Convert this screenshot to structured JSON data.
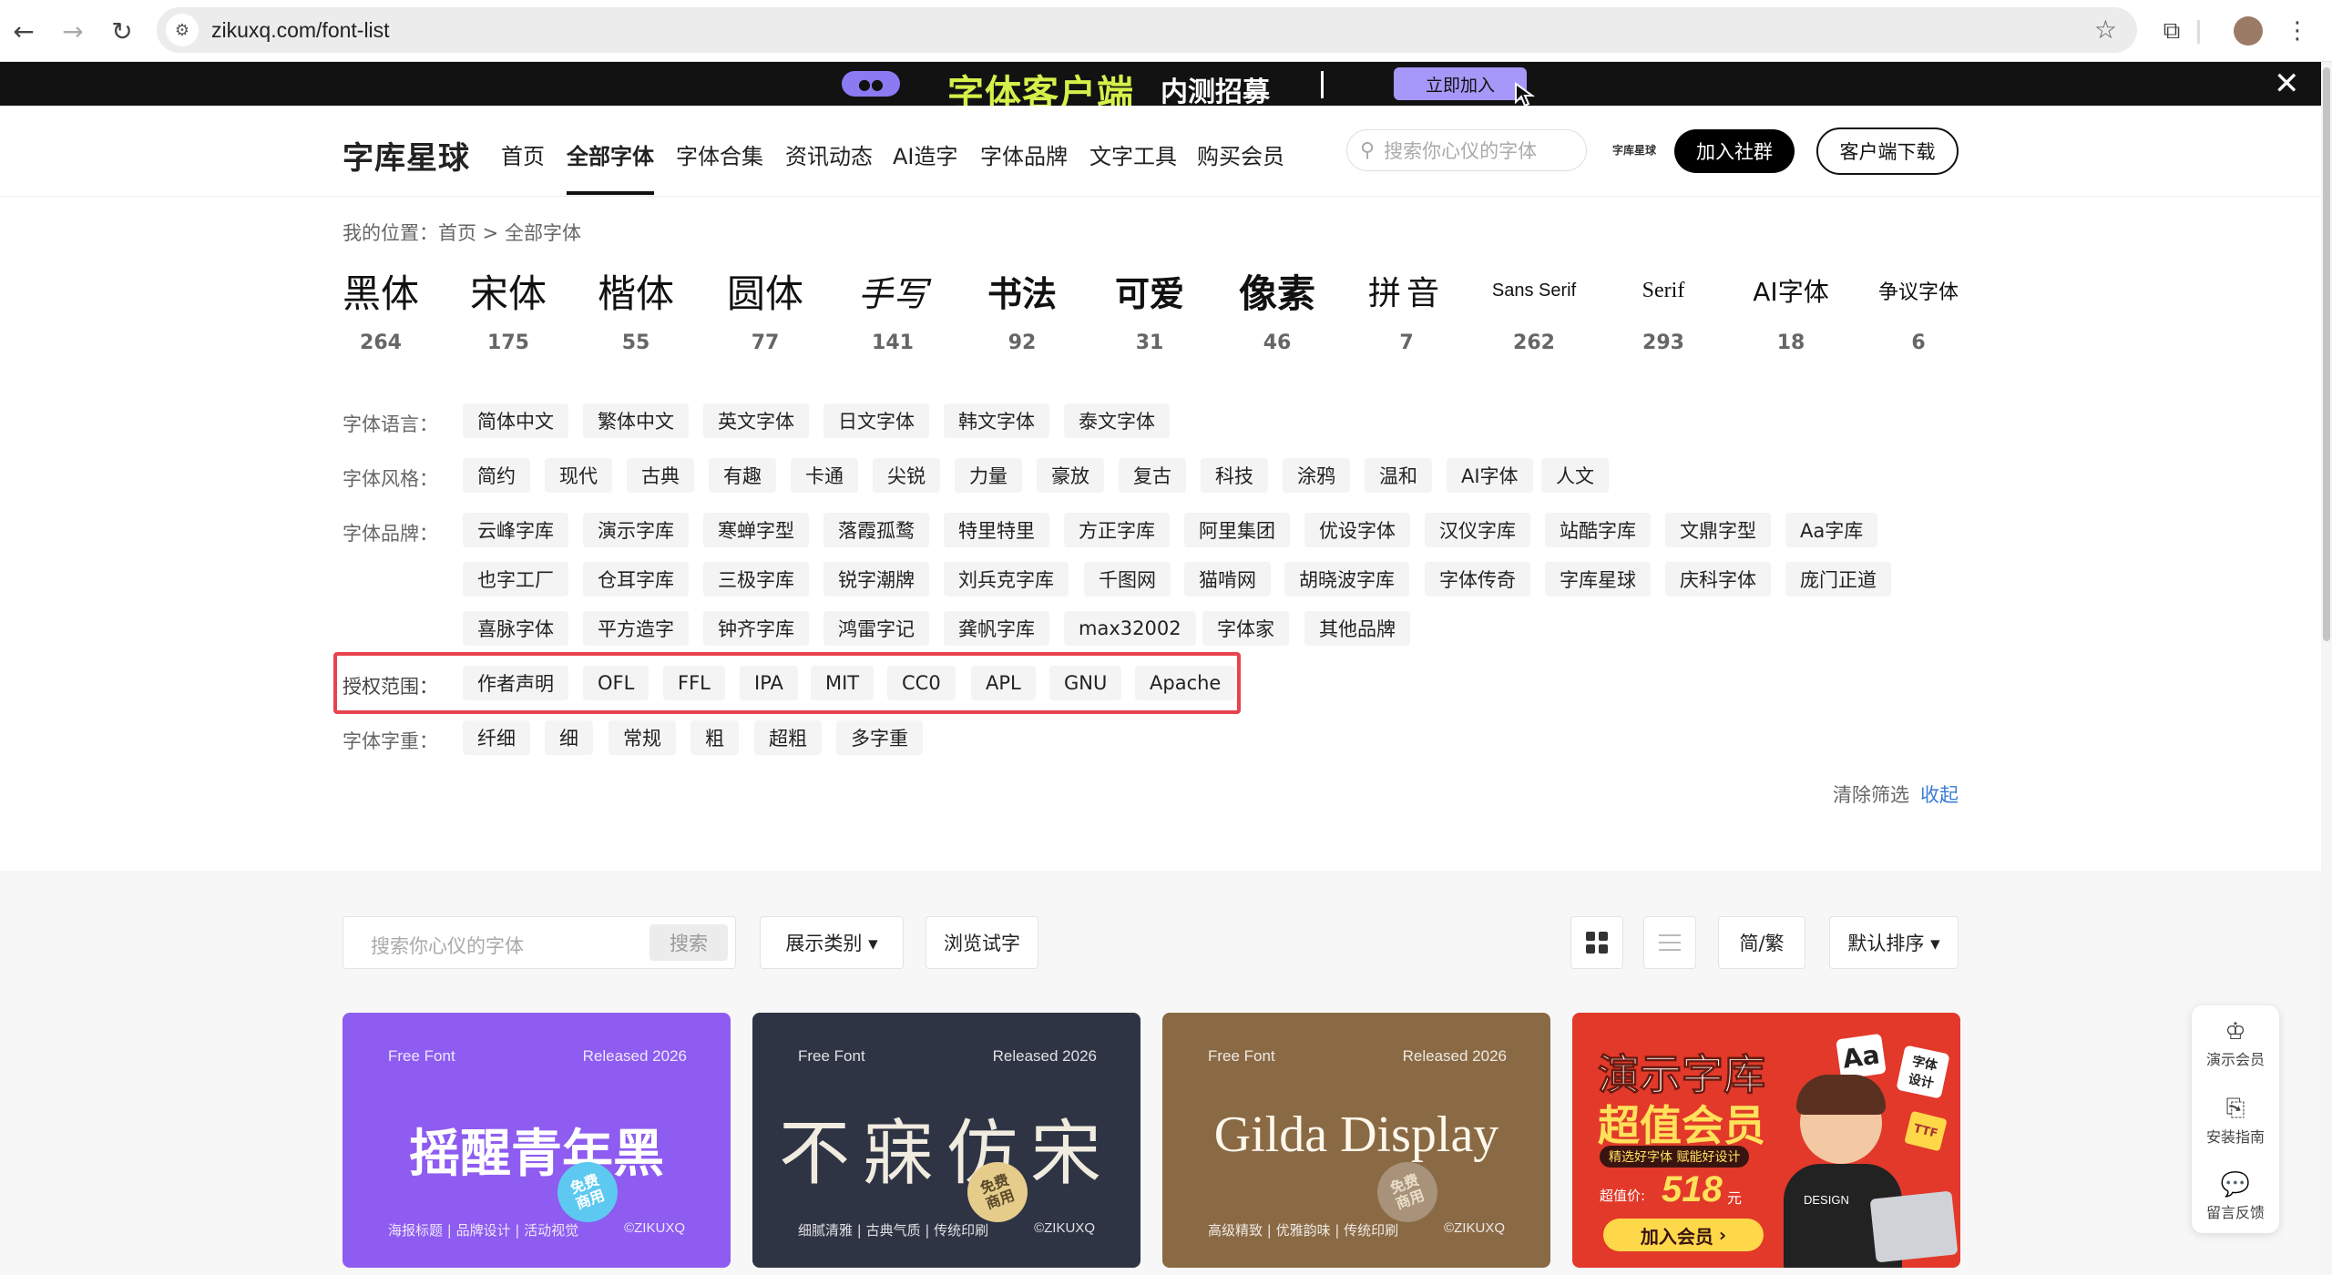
{
  "browser": {
    "url": "zikuxq.com/font-list"
  },
  "promo": {
    "pill": "●●",
    "title": "字体客户端",
    "subtitle": "内测招募",
    "join": "立即加入",
    "close": "✕"
  },
  "header": {
    "logo": "字库星球",
    "nav": [
      "首页",
      "全部字体",
      "字体合集",
      "资讯动态",
      "AI造字",
      "字体品牌",
      "文字工具",
      "购买会员"
    ],
    "search_placeholder": "搜索你心仪的字体",
    "small_logo": "字库星球",
    "community": "加入社群",
    "client": "客户端下载"
  },
  "breadcrumb": {
    "prefix": "我的位置：",
    "home": "首页",
    "sep": " > ",
    "current": "全部字体"
  },
  "categories": [
    {
      "label": "黑体",
      "count": "264"
    },
    {
      "label": "宋体",
      "count": "175"
    },
    {
      "label": "楷体",
      "count": "55"
    },
    {
      "label": "圆体",
      "count": "77"
    },
    {
      "label": "手写",
      "count": "141"
    },
    {
      "label": "书法",
      "count": "92"
    },
    {
      "label": "可爱",
      "count": "31"
    },
    {
      "label": "像素",
      "count": "46"
    },
    {
      "label": "拼音",
      "count": "7"
    },
    {
      "label": "Sans Serif",
      "count": "262"
    },
    {
      "label": "Serif",
      "count": "293"
    },
    {
      "label": "AI字体",
      "count": "18"
    },
    {
      "label": "争议字体",
      "count": "6"
    }
  ],
  "filters": {
    "language": {
      "label": "字体语言：",
      "tags": [
        "简体中文",
        "繁体中文",
        "英文字体",
        "日文字体",
        "韩文字体",
        "泰文字体"
      ]
    },
    "style": {
      "label": "字体风格：",
      "tags": [
        "简约",
        "现代",
        "古典",
        "有趣",
        "卡通",
        "尖锐",
        "力量",
        "豪放",
        "复古",
        "科技",
        "涂鸦",
        "温和",
        "AI字体",
        "人文"
      ]
    },
    "brand": {
      "label": "字体品牌：",
      "tags": [
        "云峰字库",
        "演示字库",
        "寒蝉字型",
        "落霞孤鹜",
        "特里特里",
        "方正字库",
        "阿里集团",
        "优设字体",
        "汉仪字库",
        "站酷字库",
        "文鼎字型",
        "Aa字库",
        "也字工厂",
        "仓耳字库",
        "三极字库",
        "锐字潮牌",
        "刘兵克字库",
        "千图网",
        "猫啃网",
        "胡晓波字库",
        "字体传奇",
        "字库星球",
        "庆科字体",
        "庞门正道",
        "喜脉字体",
        "平方造字",
        "钟齐字库",
        "鸿雷字记",
        "龚帆字库",
        "max32002",
        "字体家",
        "其他品牌"
      ]
    },
    "license": {
      "label": "授权范围：",
      "tags": [
        "作者声明",
        "OFL",
        "FFL",
        "IPA",
        "MIT",
        "CC0",
        "APL",
        "GNU",
        "Apache"
      ]
    },
    "weight": {
      "label": "字体字重：",
      "tags": [
        "纤细",
        "细",
        "常规",
        "粗",
        "超粗",
        "多字重"
      ]
    },
    "clear": "清除筛选",
    "collapse": "收起"
  },
  "toolbar": {
    "search_placeholder": "搜索你心仪的字体",
    "search_button": "搜索",
    "display_type": "展示类别 ▾",
    "browse": "浏览试字",
    "simp_trad": "简/繁",
    "sort": "默认排序 ▾"
  },
  "cards": [
    {
      "tag": "Free Font",
      "released": "Released 2026",
      "name": "摇醒青年黑",
      "desc": "海报标题 | 品牌设计 | 活动视觉",
      "copy": "©ZIKUXQ",
      "badge": "免费\n商用",
      "color": "#8e5cf0"
    },
    {
      "tag": "Free Font",
      "released": "Released 2026",
      "name": "不寐仿宋",
      "desc": "细腻清雅 | 古典气质 | 传统印刷",
      "copy": "©ZIKUXQ",
      "badge": "免费\n商用",
      "color": "#2f3445"
    },
    {
      "tag": "Free Font",
      "released": "Released 2026",
      "name": "Gilda Display",
      "desc": "高级精致 | 优雅韵味 | 传统印刷",
      "copy": "©ZIKUXQ",
      "badge": "免费\n商用",
      "color": "#8a6a45"
    },
    {
      "line1": "演示字库",
      "line2": "超值会员",
      "sub": "精选好字体 赋能好设计",
      "price_label": "超值价:",
      "price": "518",
      "unit": "元",
      "cta": "加入会员",
      "aa": "Aa",
      "sticker1": "字体\n设计",
      "ttf": "TTF",
      "design": "DESIGN",
      "color": "#e2392a"
    }
  ],
  "side": [
    {
      "label": "演示会员"
    },
    {
      "label": "安装指南"
    },
    {
      "label": "留言反馈"
    }
  ]
}
